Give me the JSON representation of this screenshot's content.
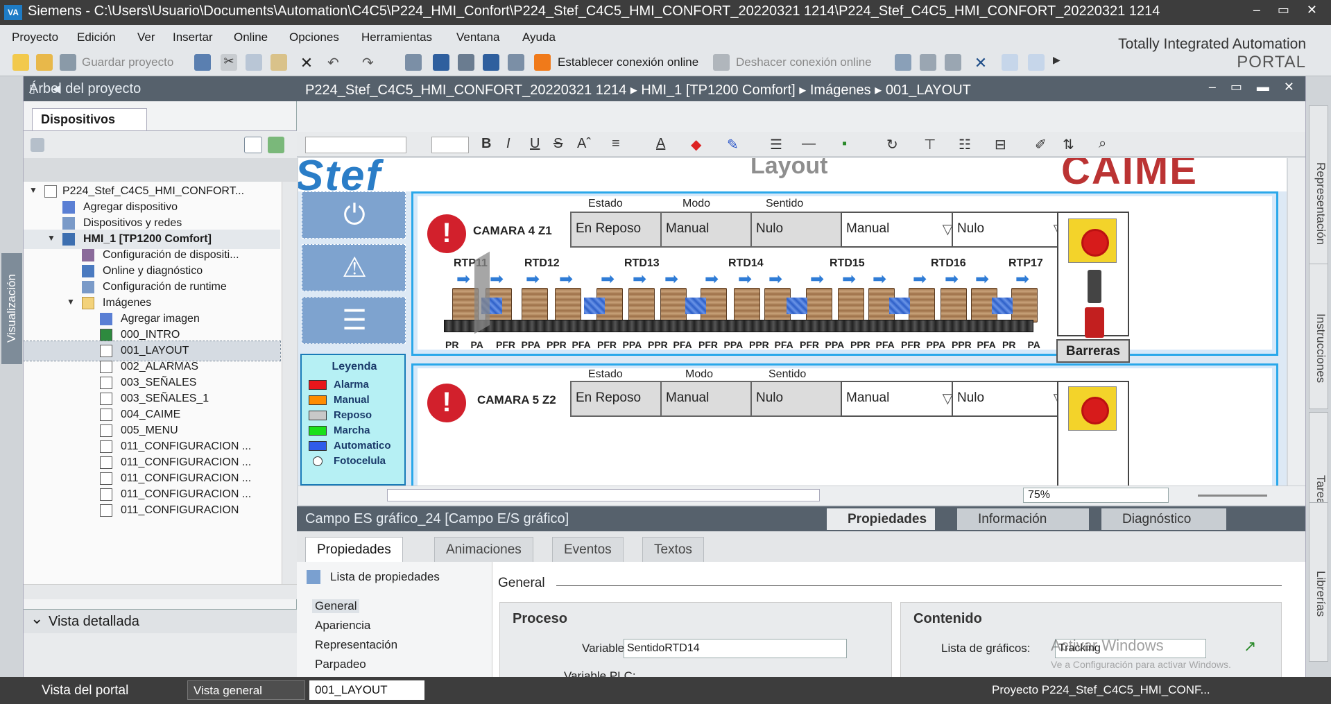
{
  "window": {
    "title": "Siemens  -  C:\\Users\\Usuario\\Documents\\Automation\\C4C5\\P224_HMI_Confort\\P224_Stef_C4C5_HMI_CONFORT_20220321 1214\\P224_Stef_C4C5_HMI_CONFORT_20220321 1214",
    "logo": "VA"
  },
  "menu": [
    "Proyecto",
    "Edición",
    "Ver",
    "Insertar",
    "Online",
    "Opciones",
    "Herramientas",
    "Ventana",
    "Ayuda"
  ],
  "toolbar": {
    "save": "Guardar proyecto",
    "connect": "Establecer conexión online",
    "disconnect": "Deshacer conexión online"
  },
  "brand": {
    "line1": "Totally Integrated Automation",
    "line2": "PORTAL"
  },
  "left_strip": {
    "label": "Visualización"
  },
  "tree": {
    "header": "Árbol del proyecto",
    "tab": "Dispositivos",
    "items": [
      "P224_Stef_C4C5_HMI_CONFORT...",
      "Agregar dispositivo",
      "Dispositivos y redes",
      "HMI_1 [TP1200 Comfort]",
      "Configuración de dispositi...",
      "Online y diagnóstico",
      "Configuración de runtime",
      "Imágenes",
      "Agregar imagen",
      "000_INTRO",
      "001_LAYOUT",
      "002_ALARMAS",
      "003_SEÑALES",
      "003_SEÑALES_1",
      "004_CAIME",
      "005_MENU",
      "011_CONFIGURACION ...",
      "011_CONFIGURACION ...",
      "011_CONFIGURACION ...",
      "011_CONFIGURACION ...",
      "011_CONFIGURACION"
    ]
  },
  "detail": {
    "title": "Vista detallada"
  },
  "editor": {
    "breadcrumb": "P224_Stef_C4C5_HMI_CONFORT_20220321 1214  ▸  HMI_1 [TP1200 Comfort]  ▸  Imágenes  ▸  001_LAYOUT",
    "zoom": "75%"
  },
  "hmi": {
    "brand_left": "Stef",
    "header_center": "Layout",
    "brand_right": "CAIME",
    "legend": {
      "title": "Leyenda",
      "items": [
        {
          "label": "Alarma",
          "color": "#e8161b"
        },
        {
          "label": "Manual",
          "color": "#ff8c00"
        },
        {
          "label": "Reposo",
          "color": "#c8c8c8"
        },
        {
          "label": "Marcha",
          "color": "#19e01a"
        },
        {
          "label": "Automatico",
          "color": "#2f5bea"
        },
        {
          "label": "Fotocelula",
          "color": "#ffffff"
        }
      ]
    },
    "col_estado": "Estado",
    "col_modo": "Modo",
    "col_sentido": "Sentido",
    "cam4": {
      "label": "CAMARA 4 Z1",
      "estado": "En Reposo",
      "modo": "Manual",
      "sentido": "Nulo",
      "dd1": "Manual",
      "dd2": "Nulo",
      "rtd": [
        "RTP11",
        "RTD12",
        "RTD13",
        "RTD14",
        "RTD15",
        "RTD16",
        "RTP17"
      ],
      "sensors": [
        "PR",
        "PA",
        "PFR",
        "PPA",
        "PPR",
        "PFA",
        "PFR",
        "PPA",
        "PPR",
        "PFA",
        "PFR",
        "PPA",
        "PPR",
        "PFA",
        "PFR",
        "PPA",
        "PPR",
        "PFA",
        "PFR",
        "PPA",
        "PPR",
        "PFA",
        "PR",
        "PA"
      ],
      "barreras": "Barreras"
    },
    "cam5": {
      "label": "CAMARA 5 Z2",
      "estado": "En Reposo",
      "modo": "Manual",
      "sentido": "Nulo",
      "dd1": "Manual",
      "dd2": "Nulo"
    }
  },
  "inspector": {
    "title": "Campo ES gráfico_24 [Campo E/S gráfico]",
    "tabs": [
      "Propiedades",
      "Información",
      "Diagnóstico"
    ],
    "subtabs": [
      "Propiedades",
      "Animaciones",
      "Eventos",
      "Textos"
    ],
    "list_header": "Lista de propiedades",
    "list": [
      "General",
      "Apariencia",
      "Representación",
      "Parpadeo"
    ],
    "section": "General",
    "proceso": {
      "title": "Proceso",
      "variable_label": "Variable:",
      "variable_value": "SentidoRTD14",
      "plc_label": "Variable PLC:"
    },
    "contenido": {
      "title": "Contenido",
      "lista_label": "Lista de gráficos:",
      "lista_value": "Tracking"
    }
  },
  "watermark": {
    "line1": "Activar Windows",
    "line2": "Ve a Configuración para activar Windows."
  },
  "right_strip": [
    "Representación",
    "Instrucciones",
    "Tareas",
    "Librerías"
  ],
  "statusbar": {
    "portal": "Vista del portal",
    "overview": "Vista general",
    "layout": "001_LAYOUT",
    "project": "Proyecto P224_Stef_C4C5_HMI_CONF..."
  }
}
